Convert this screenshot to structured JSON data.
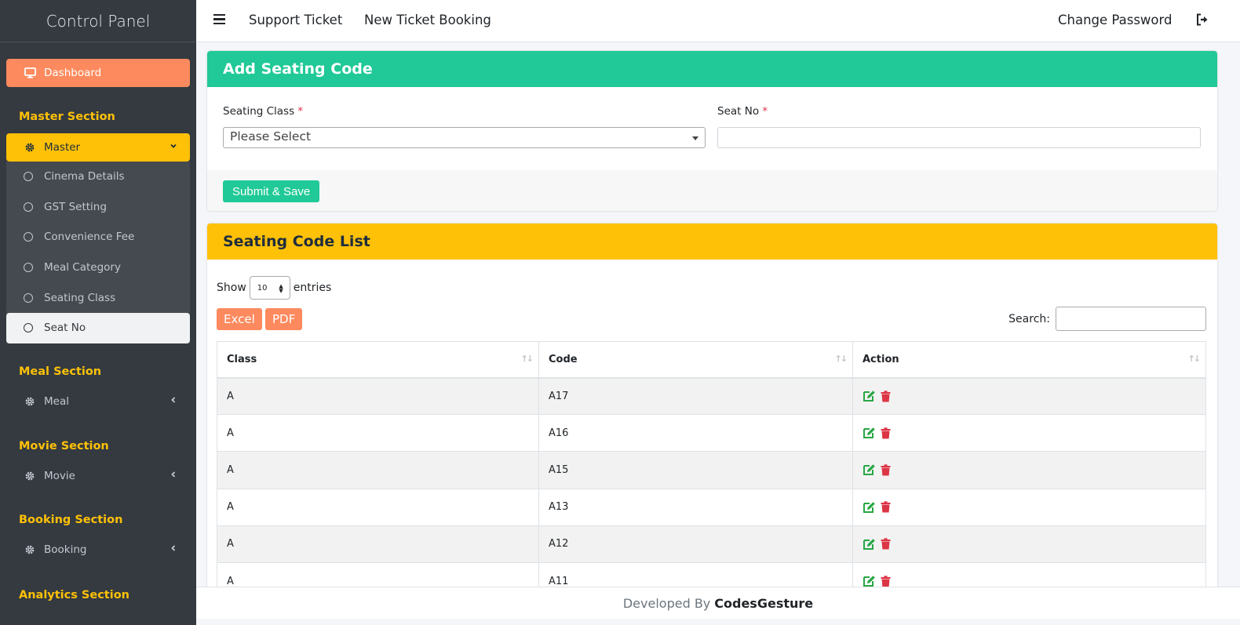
{
  "sidebar": {
    "brand": "Control Panel",
    "dashboard": "Dashboard",
    "sections": {
      "master": "Master Section",
      "meal": "Meal Section",
      "movie": "Movie Section",
      "booking": "Booking Section",
      "analytics": "Analytics Section"
    },
    "master": "Master",
    "master_items": [
      "Cinema Details",
      "GST Setting",
      "Convenience Fee",
      "Meal Category",
      "Seating Class",
      "Seat No"
    ],
    "active_item": "Seat No",
    "meal": "Meal",
    "movie": "Movie",
    "booking": "Booking",
    "colors": {
      "dashboard": "#fd8a5e",
      "master": "#ffc107",
      "section_heading": "#ffc107"
    }
  },
  "topbar": {
    "support": "Support Ticket",
    "new_booking": "New Ticket Booking",
    "change_password": "Change Password"
  },
  "form": {
    "title": "Add Seating Code",
    "seating_class_label": "Seating Class",
    "seat_no_label": "Seat No",
    "required_mark": "*",
    "seating_class_value": "Please Select",
    "seat_no_value": "",
    "submit": "Submit & Save"
  },
  "list": {
    "title": "Seating Code List",
    "show": "Show",
    "entries_value": "10",
    "entries": "entries",
    "excel": "Excel",
    "pdf": "PDF",
    "search_label": "Search:",
    "columns": [
      "Class",
      "Code",
      "Action"
    ],
    "rows": [
      {
        "class": "A",
        "code": "A17"
      },
      {
        "class": "A",
        "code": "A16"
      },
      {
        "class": "A",
        "code": "A15"
      },
      {
        "class": "A",
        "code": "A13"
      },
      {
        "class": "A",
        "code": "A12"
      },
      {
        "class": "A",
        "code": "A11"
      }
    ]
  },
  "footer": {
    "prefix": "Developed By",
    "brand": "CodesGesture"
  }
}
